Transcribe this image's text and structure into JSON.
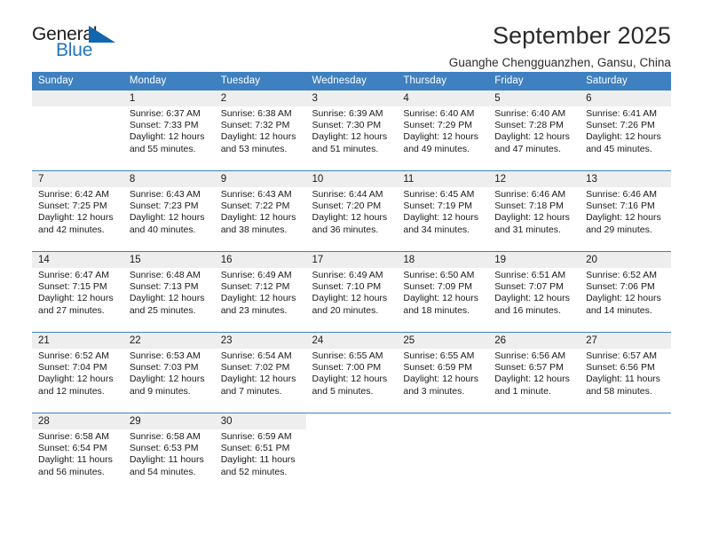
{
  "brand": {
    "name_part1": "General",
    "name_part2": "Blue",
    "triangle_color": "#1266ae",
    "blue_text_color": "#2476bd"
  },
  "header": {
    "month_title": "September 2025",
    "location": "Guanghe Chengguanzhen, Gansu, China"
  },
  "theme": {
    "header_bar_color": "#3f80c0",
    "daynum_band_color": "#eeeeee",
    "week_separator_color": "#3f80c0",
    "text_color": "#1a1a1a"
  },
  "calendar": {
    "weekday_headers": [
      "Sunday",
      "Monday",
      "Tuesday",
      "Wednesday",
      "Thursday",
      "Friday",
      "Saturday"
    ],
    "weeks": [
      [
        {
          "day": "",
          "sunrise": "",
          "sunset": "",
          "daylight_line1": "",
          "daylight_line2": "",
          "empty": true
        },
        {
          "day": "1",
          "sunrise": "Sunrise: 6:37 AM",
          "sunset": "Sunset: 7:33 PM",
          "daylight_line1": "Daylight: 12 hours",
          "daylight_line2": "and 55 minutes."
        },
        {
          "day": "2",
          "sunrise": "Sunrise: 6:38 AM",
          "sunset": "Sunset: 7:32 PM",
          "daylight_line1": "Daylight: 12 hours",
          "daylight_line2": "and 53 minutes."
        },
        {
          "day": "3",
          "sunrise": "Sunrise: 6:39 AM",
          "sunset": "Sunset: 7:30 PM",
          "daylight_line1": "Daylight: 12 hours",
          "daylight_line2": "and 51 minutes."
        },
        {
          "day": "4",
          "sunrise": "Sunrise: 6:40 AM",
          "sunset": "Sunset: 7:29 PM",
          "daylight_line1": "Daylight: 12 hours",
          "daylight_line2": "and 49 minutes."
        },
        {
          "day": "5",
          "sunrise": "Sunrise: 6:40 AM",
          "sunset": "Sunset: 7:28 PM",
          "daylight_line1": "Daylight: 12 hours",
          "daylight_line2": "and 47 minutes."
        },
        {
          "day": "6",
          "sunrise": "Sunrise: 6:41 AM",
          "sunset": "Sunset: 7:26 PM",
          "daylight_line1": "Daylight: 12 hours",
          "daylight_line2": "and 45 minutes."
        }
      ],
      [
        {
          "day": "7",
          "sunrise": "Sunrise: 6:42 AM",
          "sunset": "Sunset: 7:25 PM",
          "daylight_line1": "Daylight: 12 hours",
          "daylight_line2": "and 42 minutes."
        },
        {
          "day": "8",
          "sunrise": "Sunrise: 6:43 AM",
          "sunset": "Sunset: 7:23 PM",
          "daylight_line1": "Daylight: 12 hours",
          "daylight_line2": "and 40 minutes."
        },
        {
          "day": "9",
          "sunrise": "Sunrise: 6:43 AM",
          "sunset": "Sunset: 7:22 PM",
          "daylight_line1": "Daylight: 12 hours",
          "daylight_line2": "and 38 minutes."
        },
        {
          "day": "10",
          "sunrise": "Sunrise: 6:44 AM",
          "sunset": "Sunset: 7:20 PM",
          "daylight_line1": "Daylight: 12 hours",
          "daylight_line2": "and 36 minutes."
        },
        {
          "day": "11",
          "sunrise": "Sunrise: 6:45 AM",
          "sunset": "Sunset: 7:19 PM",
          "daylight_line1": "Daylight: 12 hours",
          "daylight_line2": "and 34 minutes."
        },
        {
          "day": "12",
          "sunrise": "Sunrise: 6:46 AM",
          "sunset": "Sunset: 7:18 PM",
          "daylight_line1": "Daylight: 12 hours",
          "daylight_line2": "and 31 minutes."
        },
        {
          "day": "13",
          "sunrise": "Sunrise: 6:46 AM",
          "sunset": "Sunset: 7:16 PM",
          "daylight_line1": "Daylight: 12 hours",
          "daylight_line2": "and 29 minutes."
        }
      ],
      [
        {
          "day": "14",
          "sunrise": "Sunrise: 6:47 AM",
          "sunset": "Sunset: 7:15 PM",
          "daylight_line1": "Daylight: 12 hours",
          "daylight_line2": "and 27 minutes."
        },
        {
          "day": "15",
          "sunrise": "Sunrise: 6:48 AM",
          "sunset": "Sunset: 7:13 PM",
          "daylight_line1": "Daylight: 12 hours",
          "daylight_line2": "and 25 minutes."
        },
        {
          "day": "16",
          "sunrise": "Sunrise: 6:49 AM",
          "sunset": "Sunset: 7:12 PM",
          "daylight_line1": "Daylight: 12 hours",
          "daylight_line2": "and 23 minutes."
        },
        {
          "day": "17",
          "sunrise": "Sunrise: 6:49 AM",
          "sunset": "Sunset: 7:10 PM",
          "daylight_line1": "Daylight: 12 hours",
          "daylight_line2": "and 20 minutes."
        },
        {
          "day": "18",
          "sunrise": "Sunrise: 6:50 AM",
          "sunset": "Sunset: 7:09 PM",
          "daylight_line1": "Daylight: 12 hours",
          "daylight_line2": "and 18 minutes."
        },
        {
          "day": "19",
          "sunrise": "Sunrise: 6:51 AM",
          "sunset": "Sunset: 7:07 PM",
          "daylight_line1": "Daylight: 12 hours",
          "daylight_line2": "and 16 minutes."
        },
        {
          "day": "20",
          "sunrise": "Sunrise: 6:52 AM",
          "sunset": "Sunset: 7:06 PM",
          "daylight_line1": "Daylight: 12 hours",
          "daylight_line2": "and 14 minutes."
        }
      ],
      [
        {
          "day": "21",
          "sunrise": "Sunrise: 6:52 AM",
          "sunset": "Sunset: 7:04 PM",
          "daylight_line1": "Daylight: 12 hours",
          "daylight_line2": "and 12 minutes."
        },
        {
          "day": "22",
          "sunrise": "Sunrise: 6:53 AM",
          "sunset": "Sunset: 7:03 PM",
          "daylight_line1": "Daylight: 12 hours",
          "daylight_line2": "and 9 minutes."
        },
        {
          "day": "23",
          "sunrise": "Sunrise: 6:54 AM",
          "sunset": "Sunset: 7:02 PM",
          "daylight_line1": "Daylight: 12 hours",
          "daylight_line2": "and 7 minutes."
        },
        {
          "day": "24",
          "sunrise": "Sunrise: 6:55 AM",
          "sunset": "Sunset: 7:00 PM",
          "daylight_line1": "Daylight: 12 hours",
          "daylight_line2": "and 5 minutes."
        },
        {
          "day": "25",
          "sunrise": "Sunrise: 6:55 AM",
          "sunset": "Sunset: 6:59 PM",
          "daylight_line1": "Daylight: 12 hours",
          "daylight_line2": "and 3 minutes."
        },
        {
          "day": "26",
          "sunrise": "Sunrise: 6:56 AM",
          "sunset": "Sunset: 6:57 PM",
          "daylight_line1": "Daylight: 12 hours",
          "daylight_line2": "and 1 minute."
        },
        {
          "day": "27",
          "sunrise": "Sunrise: 6:57 AM",
          "sunset": "Sunset: 6:56 PM",
          "daylight_line1": "Daylight: 11 hours",
          "daylight_line2": "and 58 minutes."
        }
      ],
      [
        {
          "day": "28",
          "sunrise": "Sunrise: 6:58 AM",
          "sunset": "Sunset: 6:54 PM",
          "daylight_line1": "Daylight: 11 hours",
          "daylight_line2": "and 56 minutes."
        },
        {
          "day": "29",
          "sunrise": "Sunrise: 6:58 AM",
          "sunset": "Sunset: 6:53 PM",
          "daylight_line1": "Daylight: 11 hours",
          "daylight_line2": "and 54 minutes."
        },
        {
          "day": "30",
          "sunrise": "Sunrise: 6:59 AM",
          "sunset": "Sunset: 6:51 PM",
          "daylight_line1": "Daylight: 11 hours",
          "daylight_line2": "and 52 minutes."
        },
        {
          "day": "",
          "sunrise": "",
          "sunset": "",
          "daylight_line1": "",
          "daylight_line2": "",
          "blank": true
        },
        {
          "day": "",
          "sunrise": "",
          "sunset": "",
          "daylight_line1": "",
          "daylight_line2": "",
          "blank": true
        },
        {
          "day": "",
          "sunrise": "",
          "sunset": "",
          "daylight_line1": "",
          "daylight_line2": "",
          "blank": true
        },
        {
          "day": "",
          "sunrise": "",
          "sunset": "",
          "daylight_line1": "",
          "daylight_line2": "",
          "blank": true
        }
      ]
    ]
  }
}
